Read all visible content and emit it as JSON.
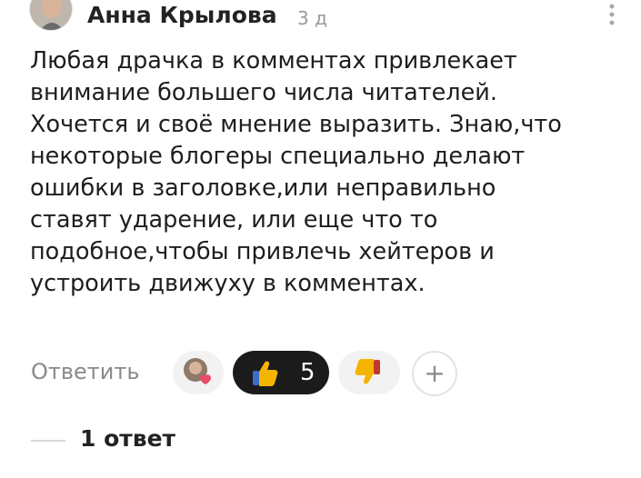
{
  "header": {
    "author": "Анна Крылова",
    "time": "3 д",
    "avatar_icon": "user-photo-avatar",
    "more_icon": "vertical-dots-icon"
  },
  "comment": {
    "lines": [
      "Любая драчка в комментах привлекает",
      "внимание большего числа читателей.",
      "Хочется и своё мнение выразить. Знаю,что",
      "некоторые блогеры специально делают",
      "ошибки в заголовке,или неправильно",
      "ставят ударение, или еще что то",
      "подобное,чтобы привлечь хейтеров и",
      "устроить движуху в комментах."
    ]
  },
  "actions": {
    "reply_label": "Ответить",
    "reacted_avatar_icon": "author-heart-avatar",
    "like_icon": "thumbs-up-emoji",
    "like_count": "5",
    "dislike_icon": "thumbs-down-emoji",
    "add_reaction_icon": "plus-icon",
    "add_reaction_symbol": "+"
  },
  "replies": {
    "label": "1 ответ"
  },
  "colors": {
    "like_pill_bg": "#1b1b1b",
    "pill_bg": "#f2f2f2",
    "muted_text": "#8a8a8a"
  }
}
